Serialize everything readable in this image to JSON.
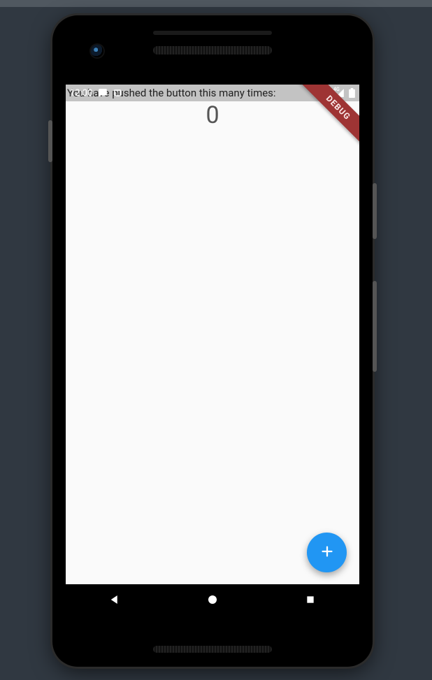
{
  "statusbar": {
    "time": "12:00",
    "signal": "4G"
  },
  "app": {
    "label": "You have pushed the button this many times:",
    "counter": "0"
  },
  "debug_banner": "DEBUG",
  "fab": {
    "tooltip": "Increment"
  },
  "colors": {
    "fab": "#2196F3"
  }
}
